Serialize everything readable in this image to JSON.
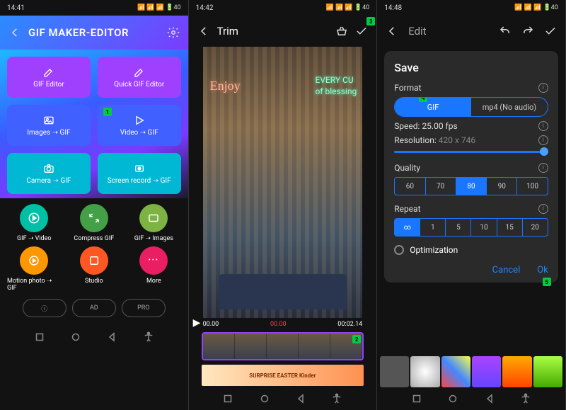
{
  "screen1": {
    "status_time": "14:41",
    "status_right": "📶 📶 📶 🔋40",
    "header_title": "GIF MAKER-EDITOR",
    "tiles": {
      "gif_editor": "GIF Editor",
      "quick_gif": "Quick GIF Editor",
      "images_gif": "Images ➝ GIF",
      "video_gif": "Video ➝ GIF",
      "camera_gif": "Camera ➝ GIF",
      "screen_gif": "Screen record ➝ GIF"
    },
    "badge_video": "1",
    "circles": {
      "gif_video": "GIF ➝ Video",
      "compress": "Compress GIF",
      "gif_images": "GIF ➝ Images",
      "motion": "Motion photo ➝ GIF",
      "studio": "Studio",
      "more": "More"
    },
    "ovals": {
      "info": "ⓘ",
      "ad": "AD",
      "pro": "PRO"
    }
  },
  "screen2": {
    "status_time": "14:42",
    "title": "Trim",
    "badge": "3",
    "neon1": "Enjoy",
    "neon2a": "EVERY CU",
    "neon2b": "of blessing",
    "time_start": "00.00",
    "time_mid": "00.00",
    "time_end": "00:02.14",
    "strip_badge": "2",
    "ad_text": "SURPRISE EASTER  Kinder"
  },
  "screen3": {
    "status_time": "14:48",
    "title": "Edit",
    "modal": {
      "heading": "Save",
      "format_label": "Format",
      "format_badge": "4",
      "fmt_gif": "GIF",
      "fmt_mp4": "mp4 (No audio)",
      "speed_label": "Speed",
      "speed_value": "25.00 fps",
      "res_label": "Resolution",
      "res_value": "420 x 746",
      "quality_label": "Quality",
      "quality_opts": [
        "60",
        "70",
        "80",
        "90",
        "100"
      ],
      "quality_sel": "80",
      "repeat_label": "Repeat",
      "repeat_opts": [
        "∞",
        "1",
        "5",
        "10",
        "15",
        "20"
      ],
      "repeat_sel": "∞",
      "optimization": "Optimization",
      "cancel": "Cancel",
      "ok": "Ok",
      "ok_badge": "5"
    }
  }
}
